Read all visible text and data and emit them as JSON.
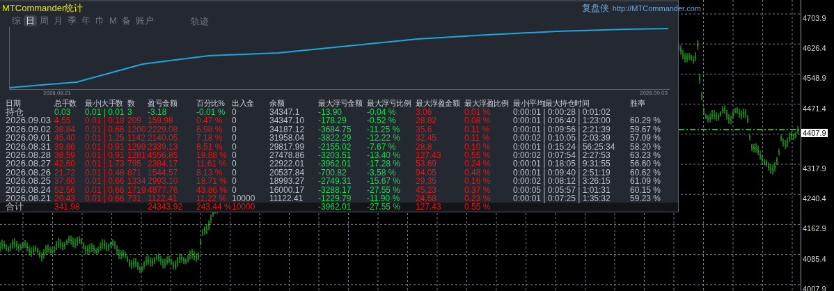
{
  "window": {
    "title": "MTCommander统计",
    "brand": "复盘侠",
    "link": "http://MTCommander.com"
  },
  "tabs": [
    {
      "label": "综",
      "selected": false
    },
    {
      "label": "日",
      "selected": true
    },
    {
      "label": "周",
      "selected": false
    },
    {
      "label": "月",
      "selected": false
    },
    {
      "label": "季",
      "selected": false
    },
    {
      "label": "年",
      "selected": false
    },
    {
      "label": "巾",
      "selected": false
    },
    {
      "label": "M",
      "selected": false
    },
    {
      "label": "备",
      "selected": false
    },
    {
      "label": "账户",
      "selected": false
    }
  ],
  "track_tab": {
    "label": "轨迹",
    "selected": false
  },
  "equity_chart": {
    "start_label": "2026.08.21",
    "end_label": "2026.09.03"
  },
  "table": {
    "columns": [
      "日期",
      "总手数",
      "最小|大手数",
      "数",
      "盈亏金额",
      "百分比%",
      "出入金",
      "余额",
      "最大浮亏金额",
      "最大浮亏比例",
      "最大浮盈金额",
      "最大浮盈比例",
      "最小|平均|最大持仓时间",
      "胜率"
    ],
    "rows": [
      {
        "kind": "position",
        "cells": [
          "持仓",
          "0.03",
          "0.01 | 0.01",
          "3",
          "-3.18",
          "-0.01 %",
          "0",
          "34347.1",
          "-13.90",
          "-0.04 %",
          "3.06",
          "0.01 %",
          "0:00:01 | 0:00:28 | 0:01:02",
          null
        ]
      },
      {
        "kind": "day",
        "cells": [
          "2026.09.03",
          "4.55",
          "0.01 | 0.18",
          "209",
          "159.98",
          "0.47 %",
          "0",
          "34347.10",
          "-178.29",
          "-0.52 %",
          "28.82",
          "0.08 %",
          "0:00:01 | 0:06:40 | 1:23:00",
          "60.29 %"
        ]
      },
      {
        "kind": "day",
        "cells": [
          "2026.09.02",
          "38.84",
          "0.01 | 0.66",
          "1200",
          "2229.08",
          "6.98 %",
          "0",
          "34187.12",
          "-3684.75",
          "-11.25 %",
          "35.6",
          "0.11 %",
          "0:00:01 | 0:09:56 | 2:21:39",
          "59.67 %"
        ]
      },
      {
        "kind": "day",
        "cells": [
          "2026.09.01",
          "45.40",
          "0.01 | 1.25",
          "1142",
          "2140.05",
          "7.18 %",
          "0",
          "31958.04",
          "-3822.29",
          "-12.22 %",
          "32.45",
          "0.11 %",
          "0:00:02 | 0:10:05 | 2:03:39",
          "57.09 %"
        ]
      },
      {
        "kind": "day",
        "cells": [
          "2026.08.31",
          "39.66",
          "0.01 | 0.91",
          "1299",
          "2339.13",
          "8.51 %",
          "0",
          "29817.99",
          "-2155.02",
          "-7.67 %",
          "28.8",
          "0.10 %",
          "0:00:01 | 0:15:24 | 56:25:34",
          "58.20 %"
        ]
      },
      {
        "kind": "day",
        "cells": [
          "2026.08.28",
          "38.59",
          "0.01 | 0.91",
          "1281",
          "4556.85",
          "19.88 %",
          "0",
          "27478.86",
          "-3203.51",
          "-13.40 %",
          "127.43",
          "0.55 %",
          "0:00:02 | 0:07:54 | 2:27:53",
          "63.23 %"
        ]
      },
      {
        "kind": "day",
        "cells": [
          "2026.08.27",
          "42.60",
          "0.01 | 1.73",
          "795",
          "2384.17",
          "11.61 %",
          "0",
          "22922.01",
          "-3962.01",
          "-17.28 %",
          "53.69",
          "0.24 %",
          "0:00:01 | 0:18:05 | 9:31:55",
          "56.60 %"
        ]
      },
      {
        "kind": "day",
        "cells": [
          "2026.08.26",
          "21.72",
          "0.01 | 0.48",
          "871",
          "1544.57",
          "8.13 %",
          "0",
          "20537.84",
          "-700.82",
          "-3.58 %",
          "94.05",
          "0.48 %",
          "0:00:01 | 0:09:40 | 2:51:19",
          "60.62 %"
        ]
      },
      {
        "kind": "day",
        "cells": [
          "2026.08.25",
          "37.60",
          "0.01 | 0.66",
          "1334",
          "2993.10",
          "18.71 %",
          "0",
          "18993.27",
          "-2749.31",
          "-15.67 %",
          "29.35",
          "0.16 %",
          "0:00:02 | 0:08:12 | 3:26:15",
          "61.09 %"
        ]
      },
      {
        "kind": "day",
        "cells": [
          "2026.08.24",
          "52.56",
          "0.01 | 0.66",
          "1719",
          "4877.76",
          "43.86 %",
          "0",
          "16000.17",
          "-3288.17",
          "-27.55 %",
          "45.23",
          "0.37 %",
          "0:00:05 | 0:05:57 | 1:01:31",
          "60.15 %"
        ]
      },
      {
        "kind": "day",
        "cells": [
          "2026.08.21",
          "20.43",
          "0.01 | 0.66",
          "731",
          "1122.41",
          "11.22 %",
          "10000",
          "11122.41",
          "-1229.79",
          "-11.90 %",
          "24.58",
          "0.23 %",
          "0:00:01 | 0:07:25 | 1:35:32",
          "59.23 %"
        ]
      },
      {
        "kind": "total",
        "cells": [
          "合计",
          "341.98",
          null,
          null,
          "24343.92",
          "243.44 %",
          "10000",
          null,
          "-3962.01",
          "-27.55 %",
          "127.43",
          "0.55 %",
          null,
          null
        ]
      }
    ]
  },
  "price_axis": {
    "upper_labels": [
      "4703.9",
      "4626.4",
      "4548.9",
      "4471.4"
    ],
    "current_price": "4407.9",
    "lower_labels": [
      "4317.9",
      "4240.4",
      "4162.9",
      "4085.4",
      "4007.9"
    ]
  }
}
